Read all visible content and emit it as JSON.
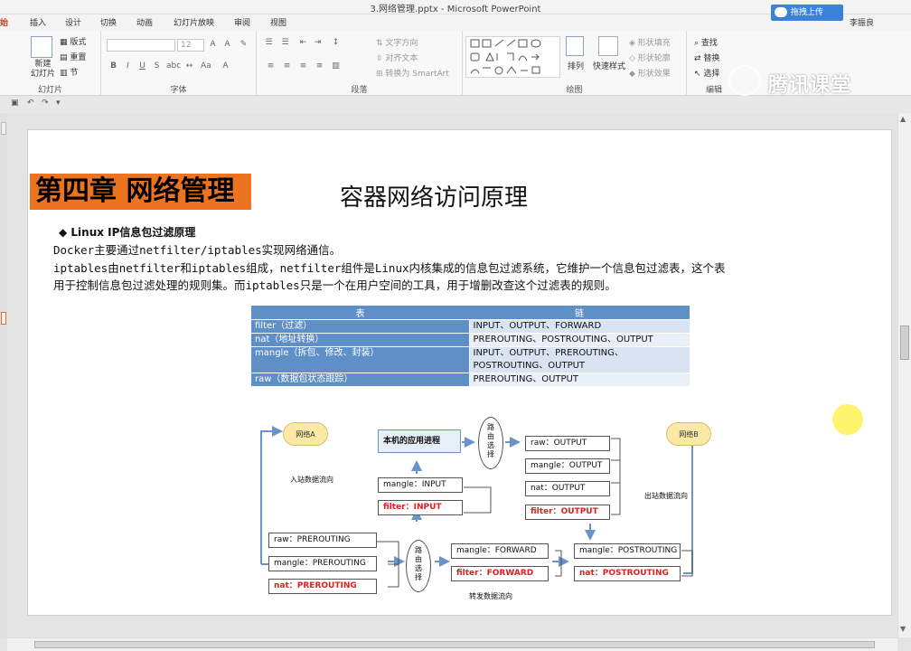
{
  "window": {
    "title": "3.网络管理.pptx - Microsoft PowerPoint",
    "cloud_upload": "拖拽上传",
    "user": "李振良"
  },
  "tabs": [
    "始",
    "插入",
    "设计",
    "切换",
    "动画",
    "幻灯片放映",
    "审阅",
    "视图"
  ],
  "ribbon": {
    "slides": {
      "new_slide": "新建\n幻灯片",
      "layout": "版式",
      "reset": "重置",
      "section": "节",
      "label": "幻灯片"
    },
    "font": {
      "size": "12",
      "label": "字体"
    },
    "paragraph": {
      "text_direction": "文字方向",
      "align_text": "对齐文本",
      "smartart": "转换为 SmartArt",
      "label": "段落"
    },
    "drawing": {
      "arrange": "排列",
      "quick_styles": "快速样式",
      "fill": "形状填充",
      "outline": "形状轮廓",
      "effects": "形状效果",
      "label": "绘图"
    },
    "editing": {
      "find": "查找",
      "replace": "替换",
      "select": "选择",
      "label": "编辑"
    }
  },
  "watermark": "腾讯课堂",
  "slide": {
    "chapter": "第四章 网络管理",
    "title": "容器网络访问原理",
    "bullet": "◆ Linux IP信息包过滤原理",
    "lines": [
      "Docker主要通过netfilter/iptables实现网络通信。",
      "iptables由netfilter和iptables组成，netfilter组件是Linux内核集成的信息包过滤系统，它维护一个信息包过滤表，这个表",
      "用于控制信息包过滤处理的规则集。而iptables只是一个在用户空间的工具，用于增删改查这个过滤表的规则。"
    ],
    "table": {
      "headers": [
        "表",
        "链"
      ],
      "rows": [
        [
          "filter（过滤）",
          "INPUT、OUTPUT、FORWARD"
        ],
        [
          "nat（地址转换）",
          "PREROUTING、POSTROUTING、OUTPUT"
        ],
        [
          "mangle（拆包、修改、封装）",
          "INPUT、OUTPUT、PREROUTING、\nPOSTROUTING、OUTPUT"
        ],
        [
          "raw（数据包状态跟踪）",
          "PREROUTING、OUTPUT"
        ]
      ]
    },
    "diagram": {
      "net_a": "网络A",
      "net_b": "网络B",
      "inbound": "入站数据流向",
      "outbound": "出站数据流向",
      "forward": "转发数据流向",
      "app": "本机的应用进程",
      "routing": "路由选择",
      "mangle_input": "mangle：INPUT",
      "filter_input": "filter：INPUT",
      "raw_pre": "raw：PREROUTING",
      "mangle_pre": "mangle：PREROUTING",
      "nat_pre": "nat：PREROUTING",
      "mangle_fwd": "mangle：FORWARD",
      "filter_fwd": "filter：FORWARD",
      "raw_out": "raw：OUTPUT",
      "mangle_out": "mangle：OUTPUT",
      "nat_out": "nat：OUTPUT",
      "filter_out": "filter：OUTPUT",
      "mangle_post": "mangle：POSTROUTING",
      "nat_post": "nat：POSTROUTING"
    }
  }
}
